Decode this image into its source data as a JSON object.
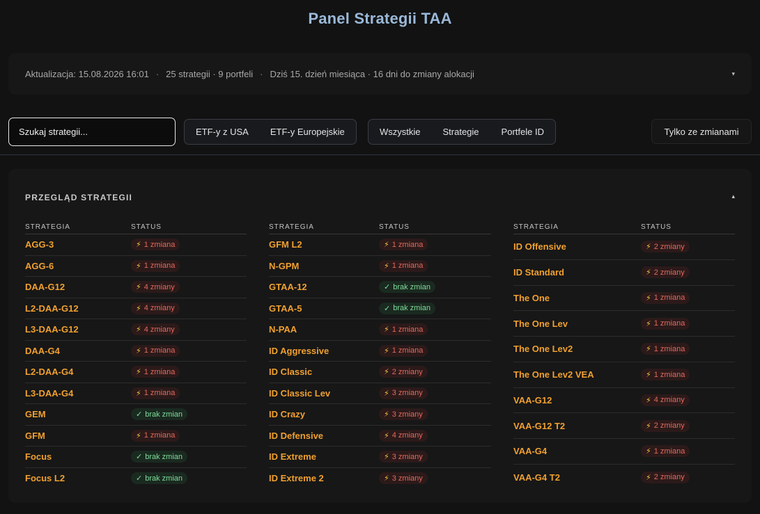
{
  "header": {
    "title": "Panel Strategii TAA"
  },
  "info": {
    "updated": "Aktualizacja: 15.08.2026 16:01",
    "sep1": "·",
    "counts": "25 strategii · 9 portfeli",
    "sep2": "·",
    "schedule": "Dziś 15. dzień miesiąca · 16 dni do zmiany alokacji",
    "chevron": "▾"
  },
  "toolbar": {
    "search_placeholder": "Szukaj strategii...",
    "etf_filters": [
      "ETF-y z USA",
      "ETF-y Europejskie"
    ],
    "type_filters": [
      "Wszystkie",
      "Strategie",
      "Portfele ID"
    ],
    "only_changes": "Tylko ze zmianami"
  },
  "panel": {
    "title": "PRZEGLĄD STRATEGII",
    "chevron": "▴",
    "col_strategy": "STRATEGIA",
    "col_status": "STATUS",
    "columns": [
      [
        {
          "name": "AGG-3",
          "status": "1 zmiana",
          "changed": true
        },
        {
          "name": "AGG-6",
          "status": "1 zmiana",
          "changed": true
        },
        {
          "name": "DAA-G12",
          "status": "4 zmiany",
          "changed": true
        },
        {
          "name": "L2-DAA-G12",
          "status": "4 zmiany",
          "changed": true
        },
        {
          "name": "L3-DAA-G12",
          "status": "4 zmiany",
          "changed": true
        },
        {
          "name": "DAA-G4",
          "status": "1 zmiana",
          "changed": true
        },
        {
          "name": "L2-DAA-G4",
          "status": "1 zmiana",
          "changed": true
        },
        {
          "name": "L3-DAA-G4",
          "status": "1 zmiana",
          "changed": true
        },
        {
          "name": "GEM",
          "status": "brak zmian",
          "changed": false
        },
        {
          "name": "GFM",
          "status": "1 zmiana",
          "changed": true
        },
        {
          "name": "Focus",
          "status": "brak zmian",
          "changed": false
        },
        {
          "name": "Focus L2",
          "status": "brak zmian",
          "changed": false
        }
      ],
      [
        {
          "name": "GFM L2",
          "status": "1 zmiana",
          "changed": true
        },
        {
          "name": "N-GPM",
          "status": "1 zmiana",
          "changed": true
        },
        {
          "name": "GTAA-12",
          "status": "brak zmian",
          "changed": false
        },
        {
          "name": "GTAA-5",
          "status": "brak zmian",
          "changed": false
        },
        {
          "name": "N-PAA",
          "status": "1 zmiana",
          "changed": true
        },
        {
          "name": "ID Aggressive",
          "status": "1 zmiana",
          "changed": true
        },
        {
          "name": "ID Classic",
          "status": "2 zmiany",
          "changed": true
        },
        {
          "name": "ID Classic Lev",
          "status": "3 zmiany",
          "changed": true
        },
        {
          "name": "ID Crazy",
          "status": "3 zmiany",
          "changed": true
        },
        {
          "name": "ID Defensive",
          "status": "4 zmiany",
          "changed": true
        },
        {
          "name": "ID Extreme",
          "status": "3 zmiany",
          "changed": true
        },
        {
          "name": "ID Extreme 2",
          "status": "3 zmiany",
          "changed": true
        }
      ],
      [
        {
          "name": "ID Offensive",
          "status": "2 zmiany",
          "changed": true
        },
        {
          "name": "ID Standard",
          "status": "2 zmiany",
          "changed": true
        },
        {
          "name": "The One",
          "status": "1 zmiana",
          "changed": true
        },
        {
          "name": "The One Lev",
          "status": "1 zmiana",
          "changed": true
        },
        {
          "name": "The One Lev2",
          "status": "1 zmiana",
          "changed": true
        },
        {
          "name": "The One Lev2 VEA",
          "status": "1 zmiana",
          "changed": true
        },
        {
          "name": "VAA-G12",
          "status": "4 zmiany",
          "changed": true
        },
        {
          "name": "VAA-G12 T2",
          "status": "2 zmiany",
          "changed": true
        },
        {
          "name": "VAA-G4",
          "status": "1 zmiana",
          "changed": true
        },
        {
          "name": "VAA-G4 T2",
          "status": "2 zmiany",
          "changed": true
        }
      ]
    ]
  },
  "icons": {
    "change": "lightning-icon",
    "ok": "checkmark-icon"
  },
  "colors": {
    "accent": "#f0a030",
    "title": "#9ab8d8",
    "change": "#e36a5c",
    "ok": "#7fdc9a"
  }
}
